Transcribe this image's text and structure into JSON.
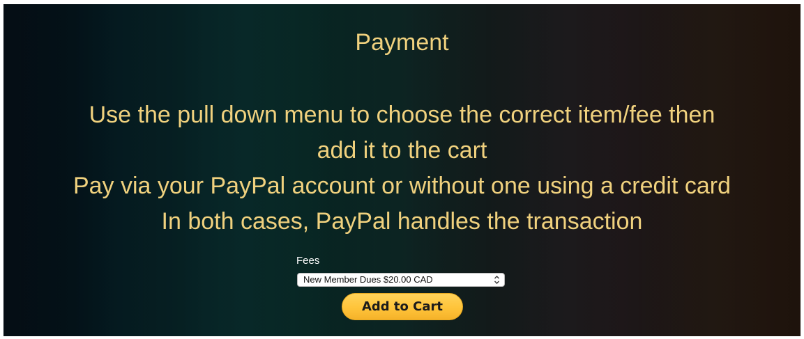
{
  "page": {
    "heading": "Payment",
    "instructions": [
      "Use the pull down menu to choose the correct item/fee then",
      "add it to the cart",
      "Pay via your PayPal account or without one using a credit card",
      "In both cases, PayPal handles the transaction"
    ]
  },
  "form": {
    "fees_label": "Fees",
    "fees_select_value": "New Member Dues $20.00 CAD",
    "add_to_cart_label": "Add to Cart"
  },
  "icons": {
    "select_arrows": "chevron-up-down-icon"
  },
  "colors": {
    "heading_text": "#f0d17e",
    "button_gold": "#ffc43a",
    "label_text": "#ffffff"
  }
}
